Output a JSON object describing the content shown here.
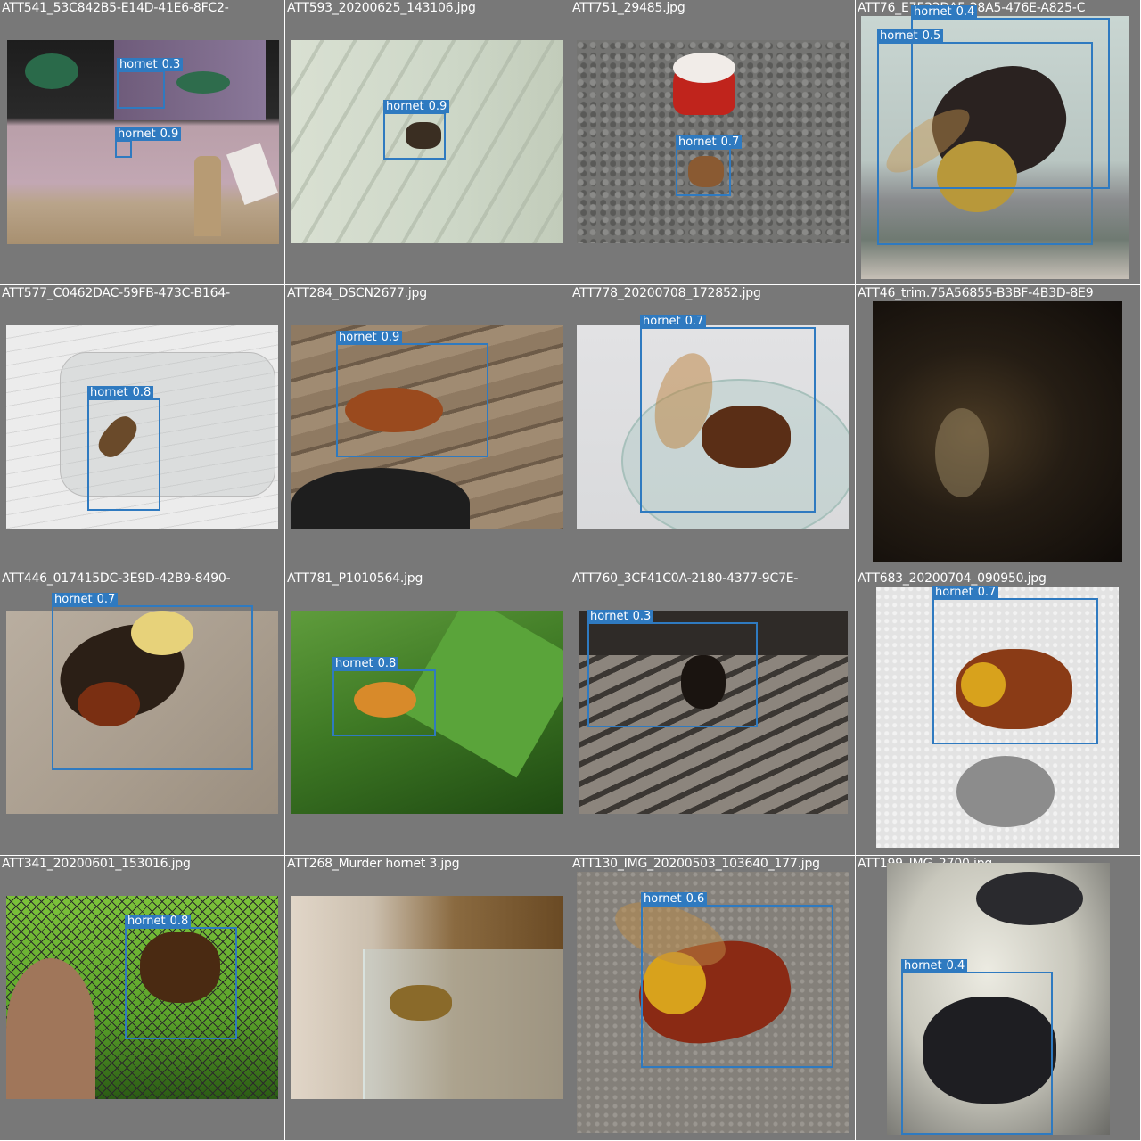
{
  "detection_color": "#2f7ac0",
  "tiles": [
    {
      "title": "ATT541_53C842B5-E14D-41E6-8FC2-",
      "detections": [
        {
          "cls": "hornet",
          "conf": "0.3"
        },
        {
          "cls": "hornet",
          "conf": "0.9"
        }
      ]
    },
    {
      "title": "ATT593_20200625_143106.jpg",
      "detections": [
        {
          "cls": "hornet",
          "conf": "0.9"
        }
      ]
    },
    {
      "title": "ATT751_29485.jpg",
      "detections": [
        {
          "cls": "hornet",
          "conf": "0.7"
        }
      ]
    },
    {
      "title": "ATT76_E7532DA5-28A5-476E-A825-C",
      "detections": [
        {
          "cls": "hornet",
          "conf": "0.4"
        },
        {
          "cls": "hornet",
          "conf": "0.5"
        }
      ]
    },
    {
      "title": "ATT577_C0462DAC-59FB-473C-B164-",
      "detections": [
        {
          "cls": "hornet",
          "conf": "0.8"
        }
      ]
    },
    {
      "title": "ATT284_DSCN2677.jpg",
      "detections": [
        {
          "cls": "hornet",
          "conf": "0.9"
        }
      ]
    },
    {
      "title": "ATT778_20200708_172852.jpg",
      "detections": [
        {
          "cls": "hornet",
          "conf": "0.7"
        }
      ]
    },
    {
      "title": "ATT46_trim.75A56855-B3BF-4B3D-8E9",
      "detections": []
    },
    {
      "title": "ATT446_017415DC-3E9D-42B9-8490-",
      "detections": [
        {
          "cls": "hornet",
          "conf": "0.7"
        }
      ]
    },
    {
      "title": "ATT781_P1010564.jpg",
      "detections": [
        {
          "cls": "hornet",
          "conf": "0.8"
        }
      ]
    },
    {
      "title": "ATT760_3CF41C0A-2180-4377-9C7E-",
      "detections": [
        {
          "cls": "hornet",
          "conf": "0.3"
        }
      ]
    },
    {
      "title": "ATT683_20200704_090950.jpg",
      "detections": [
        {
          "cls": "hornet",
          "conf": "0.7"
        }
      ]
    },
    {
      "title": "ATT341_20200601_153016.jpg",
      "detections": [
        {
          "cls": "hornet",
          "conf": "0.8"
        }
      ]
    },
    {
      "title": "ATT268_Murder hornet 3.jpg",
      "detections": []
    },
    {
      "title": "ATT130_IMG_20200503_103640_177.jpg",
      "detections": [
        {
          "cls": "hornet",
          "conf": "0.6"
        }
      ]
    },
    {
      "title": "ATT199_IMG_2700.jpg",
      "detections": [
        {
          "cls": "hornet",
          "conf": "0.4"
        }
      ]
    }
  ]
}
